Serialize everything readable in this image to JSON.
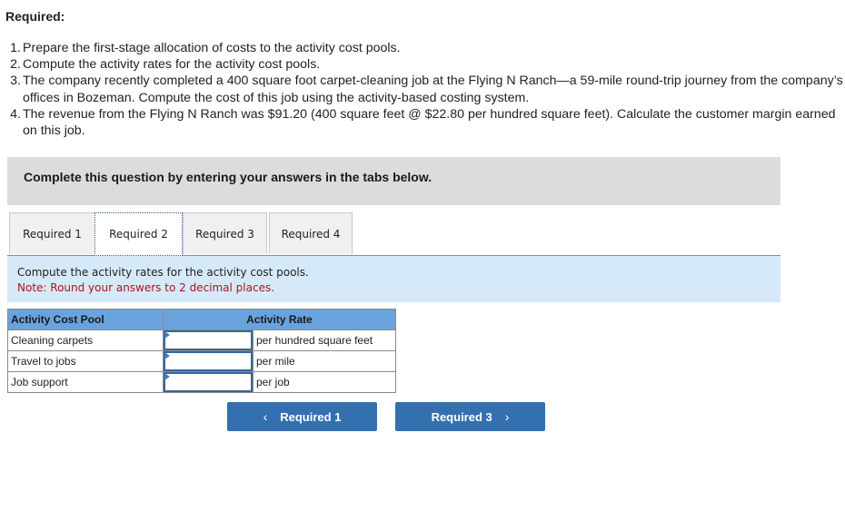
{
  "heading": "Required:",
  "requirements": [
    {
      "num": "1.",
      "text": "Prepare the first-stage allocation of costs to the activity cost pools."
    },
    {
      "num": "2.",
      "text": "Compute the activity rates for the activity cost pools."
    },
    {
      "num": "3.",
      "text": "The company recently completed a 400 square foot carpet-cleaning job at the Flying N Ranch—a 59-mile round-trip journey from the company’s offices in Bozeman. Compute the cost of this job using the activity-based costing system."
    },
    {
      "num": "4.",
      "text": "The revenue from the Flying N Ranch was $91.20 (400 square feet @ $22.80 per hundred square feet). Calculate the customer margin earned on this job."
    }
  ],
  "instruction": "Complete this question by entering your answers in the tabs below.",
  "tabs": [
    {
      "label": "Required 1",
      "active": false
    },
    {
      "label": "Required 2",
      "active": true
    },
    {
      "label": "Required 3",
      "active": false
    },
    {
      "label": "Required 4",
      "active": false
    }
  ],
  "prompt": {
    "text": "Compute the activity rates for the activity cost pools.",
    "note": "Note: Round your answers to 2 decimal places."
  },
  "table": {
    "headers": {
      "pool": "Activity Cost Pool",
      "rate": "Activity Rate"
    },
    "rows": [
      {
        "pool": "Cleaning carpets",
        "value": "",
        "unit": "per hundred square feet"
      },
      {
        "pool": "Travel to jobs",
        "value": "",
        "unit": "per mile"
      },
      {
        "pool": "Job support",
        "value": "",
        "unit": "per job"
      }
    ]
  },
  "nav": {
    "prev_label": "Required 1",
    "prev_icon": "‹",
    "next_label": "Required 3",
    "next_icon": "›"
  },
  "colors": {
    "header_bg": "#6aa3dc",
    "button_bg": "#3470b0",
    "prompt_bg": "#d6e9f8",
    "note_color": "#b0121b"
  }
}
